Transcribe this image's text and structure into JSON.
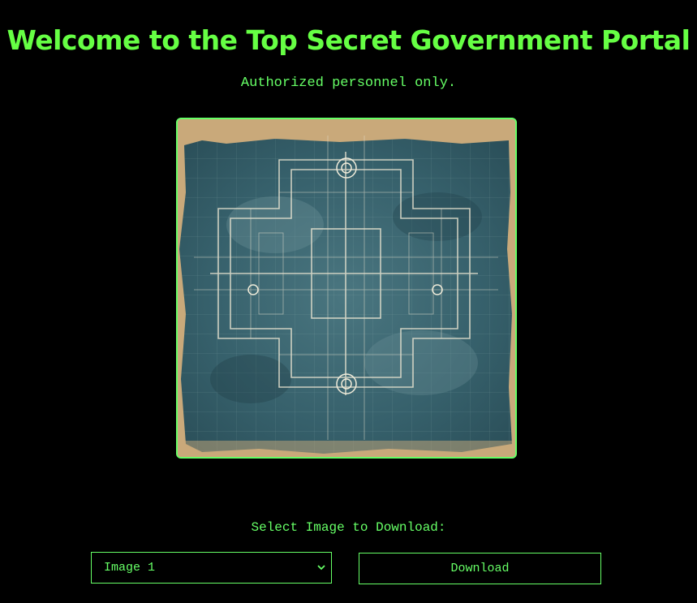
{
  "header": {
    "title": "Welcome to the Top Secret Government Portal",
    "subtitle": "Authorized personnel only."
  },
  "image": {
    "icon": "blueprint-floorplan-image"
  },
  "download": {
    "label": "Select Image to Download:",
    "selected_option": "Image 1",
    "button_label": "Download"
  },
  "colors": {
    "background": "#000000",
    "accent": "#66ff66",
    "blueprint": "#3e6670",
    "paper": "#c9a97a"
  }
}
